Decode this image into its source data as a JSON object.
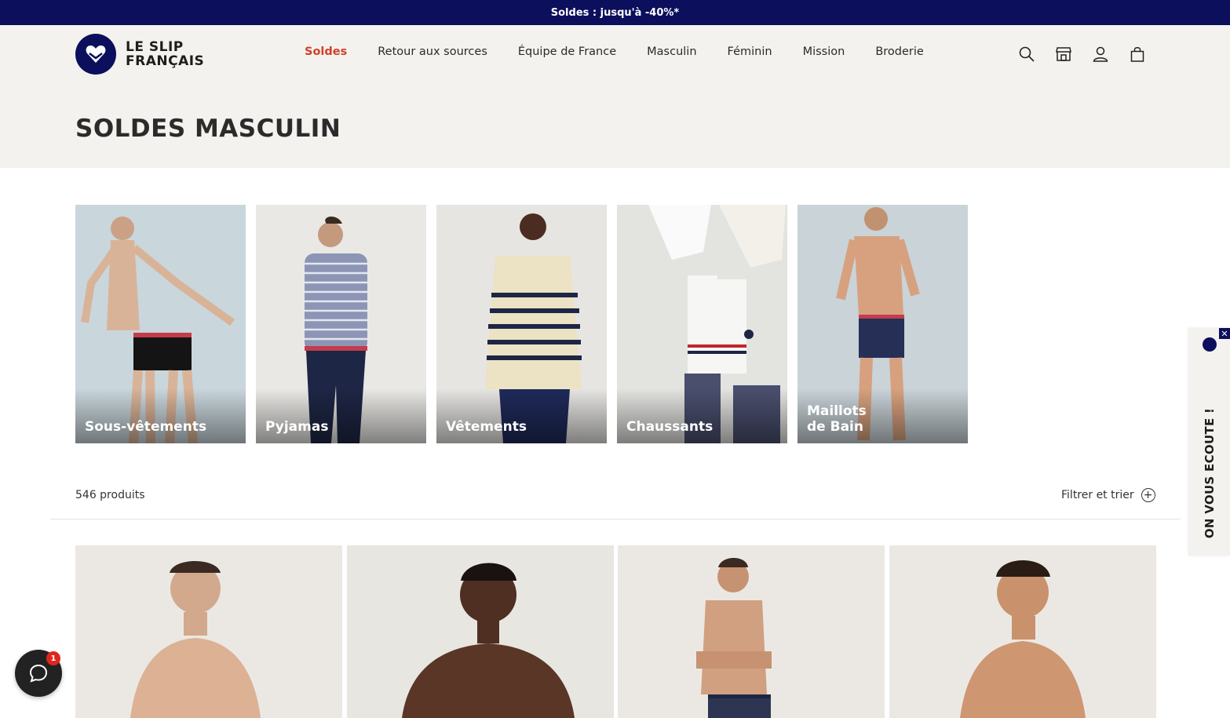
{
  "promo": {
    "text": "Soldes : jusqu'à -40%*"
  },
  "brand": {
    "line1": "LE SLIP",
    "line2": "FRANÇAIS"
  },
  "nav": {
    "items": [
      {
        "label": "Soldes"
      },
      {
        "label": "Retour aux sources"
      },
      {
        "label": "Équipe de France"
      },
      {
        "label": "Masculin"
      },
      {
        "label": "Féminin"
      },
      {
        "label": "Mission"
      },
      {
        "label": "Broderie"
      }
    ]
  },
  "header_icons": [
    "search-icon",
    "store-icon",
    "account-icon",
    "bag-icon"
  ],
  "page": {
    "title": "SOLDES MASCULIN"
  },
  "categories": [
    {
      "label": "Sous-vêtements"
    },
    {
      "label": "Pyjamas"
    },
    {
      "label": "Vêtements"
    },
    {
      "label": "Chaussants"
    },
    {
      "label": "Maillots\nde Bain"
    }
  ],
  "listing": {
    "count": "546 produits",
    "filter_label": "Filtrer et trier"
  },
  "side_tab": {
    "label": "ON VOUS ECOUTE !",
    "close": "✕"
  },
  "chat": {
    "badge": "1"
  },
  "colors": {
    "navy": "#0b0f5c",
    "sale_red": "#d0402a",
    "hero_bg": "#f4f2ee"
  }
}
